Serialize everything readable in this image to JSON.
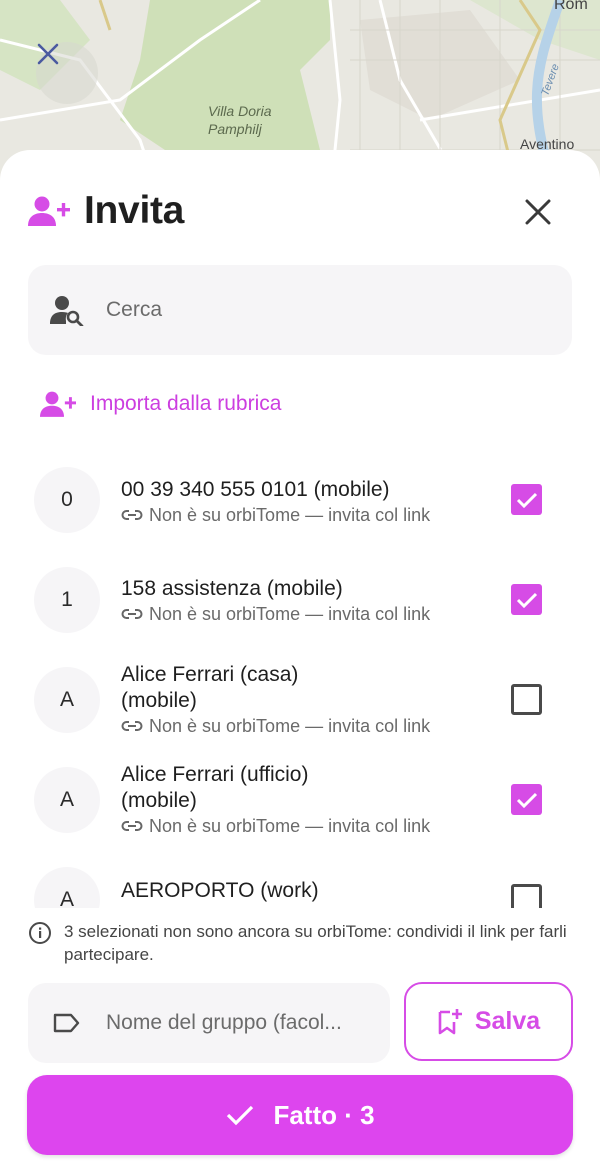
{
  "colors": {
    "accent": "#d64ce6",
    "accent_button": "#dd45ee",
    "field_bg": "#f6f5f7"
  },
  "map": {
    "place_label": "Villa Doria\nPamphilj",
    "city_label": "Rom",
    "area_label": "Aventino",
    "road_label": "Tevere",
    "close_icon": "close-icon"
  },
  "header": {
    "icon": "person-add-icon",
    "title": "Invita",
    "close_icon": "close-icon"
  },
  "search": {
    "icon": "person-search-icon",
    "placeholder": "Cerca"
  },
  "import": {
    "icon": "person-add-icon",
    "label": "Importa dalla rubrica"
  },
  "contacts": [
    {
      "initial": "0",
      "name": "00 39 340 555 0101 (mobile)",
      "status": "Non è su orbiTome — invita col link",
      "checked": true
    },
    {
      "initial": "1",
      "name": "158 assistenza (mobile)",
      "status": "Non è su orbiTome — invita col link",
      "checked": true
    },
    {
      "initial": "A",
      "name": "Alice Ferrari (casa)\n(mobile)",
      "status": "Non è su orbiTome — invita col link",
      "checked": false
    },
    {
      "initial": "A",
      "name": "Alice Ferrari (ufficio)\n(mobile)",
      "status": "Non è su orbiTome — invita col link",
      "checked": true
    },
    {
      "initial": "A",
      "name": "AEROPORTO (work)",
      "status": "",
      "checked": false
    }
  ],
  "info": {
    "icon": "info-icon",
    "text": "3 selezionati non sono ancora su orbiTome: condividi il link per farli partecipare."
  },
  "group": {
    "icon": "label-icon",
    "placeholder": "Nome del gruppo (facol..."
  },
  "save": {
    "icon": "bookmark-add-icon",
    "label": "Salva"
  },
  "done": {
    "icon": "check-icon",
    "label": "Fatto · 3"
  }
}
